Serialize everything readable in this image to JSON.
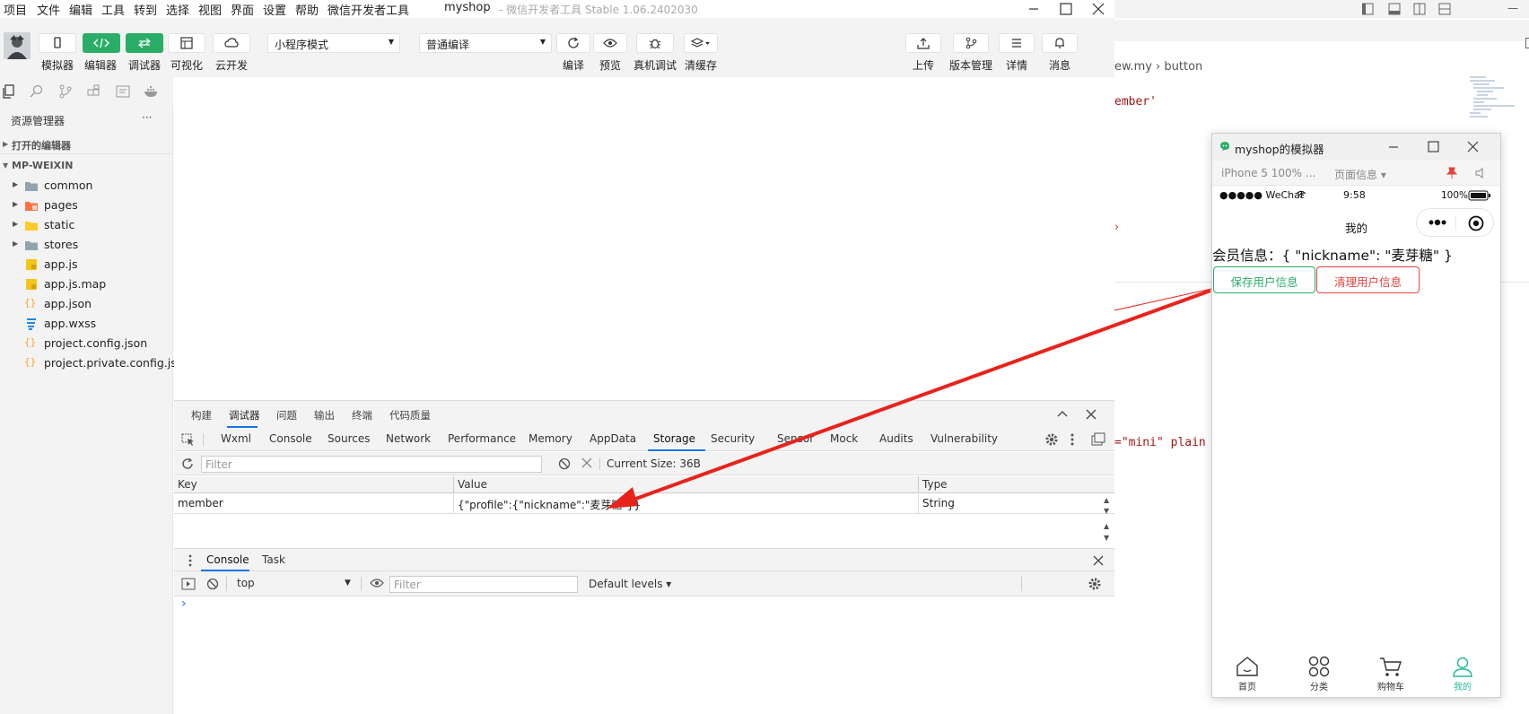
{
  "menubar": {
    "items": [
      "项目",
      "文件",
      "编辑",
      "工具",
      "转到",
      "选择",
      "视图",
      "界面",
      "设置",
      "帮助",
      "微信开发者工具"
    ],
    "title": "myshop",
    "subtitle": "- 微信开发者工具 Stable 1.06.2402030"
  },
  "toolbar": {
    "simulator": "模拟器",
    "editor": "编辑器",
    "debugger": "调试器",
    "visual": "可视化",
    "cloud": "云开发",
    "mode_select": "小程序模式",
    "compile_select": "普通编译",
    "compile": "编译",
    "preview": "预览",
    "real_debug": "真机调试",
    "clear_cache": "清缓存",
    "upload": "上传",
    "version": "版本管理",
    "details": "详情",
    "messages": "消息",
    "accent_green": "#2aae67"
  },
  "explorer": {
    "title": "资源管理器",
    "more": "···",
    "open_editors": "打开的编辑器",
    "project": "MP-WEIXIN",
    "files": [
      {
        "name": "common",
        "type": "folder"
      },
      {
        "name": "pages",
        "type": "folder-pages"
      },
      {
        "name": "static",
        "type": "folder-static"
      },
      {
        "name": "stores",
        "type": "folder"
      },
      {
        "name": "app.js",
        "type": "js"
      },
      {
        "name": "app.js.map",
        "type": "js"
      },
      {
        "name": "app.json",
        "type": "json"
      },
      {
        "name": "app.wxss",
        "type": "css"
      },
      {
        "name": "project.config.json",
        "type": "json"
      },
      {
        "name": "project.private.config.js...",
        "type": "json"
      }
    ]
  },
  "debug": {
    "tabs": [
      "构建",
      "调试器",
      "问题",
      "输出",
      "终端",
      "代码质量"
    ],
    "devtools_tabs": [
      "Wxml",
      "Console",
      "Sources",
      "Network",
      "Performance",
      "Memory",
      "AppData",
      "Storage",
      "Security",
      "Sensor",
      "Mock",
      "Audits",
      "Vulnerability"
    ],
    "filter_placeholder": "Filter",
    "current_size": "Current Size: 36B",
    "columns": {
      "key": "Key",
      "value": "Value",
      "type": "Type"
    },
    "row": {
      "key": "member",
      "value": "{\"profile\":{\"nickname\":\"麦芽糖\"}}",
      "type": "String"
    },
    "console_tabs": [
      "Console",
      "Task"
    ],
    "context": "top",
    "console_filter": "Filter",
    "levels": "Default levels ▾",
    "prompt": "›"
  },
  "editor_bg": {
    "breadcrumb": "ew.my  ›  button",
    "code1": "ember'",
    "code2": "=\"mini\" plain t"
  },
  "simulator": {
    "title": "myshop的模拟器",
    "device": "iPhone 5 100% ...",
    "page_info": "页面信息 ▾",
    "carrier": "●●●●● WeChat",
    "time": "9:58",
    "battery": "100%",
    "nav_title": "我的",
    "member_text": "会员信息：{ \"nickname\": \"麦芽糖\" }",
    "save_button": "保存用户信息",
    "clear_button": "清理用户信息",
    "save_color": "#2aae67",
    "clear_color": "#e64340",
    "tabs": [
      {
        "label": "首页",
        "icon": "home-icon"
      },
      {
        "label": "分类",
        "icon": "category-icon"
      },
      {
        "label": "购物车",
        "icon": "cart-icon"
      },
      {
        "label": "我的",
        "icon": "user-icon"
      }
    ],
    "active_tab_color": "#27ba9b"
  },
  "annotation": {
    "arrow_color": "#e8231c"
  }
}
